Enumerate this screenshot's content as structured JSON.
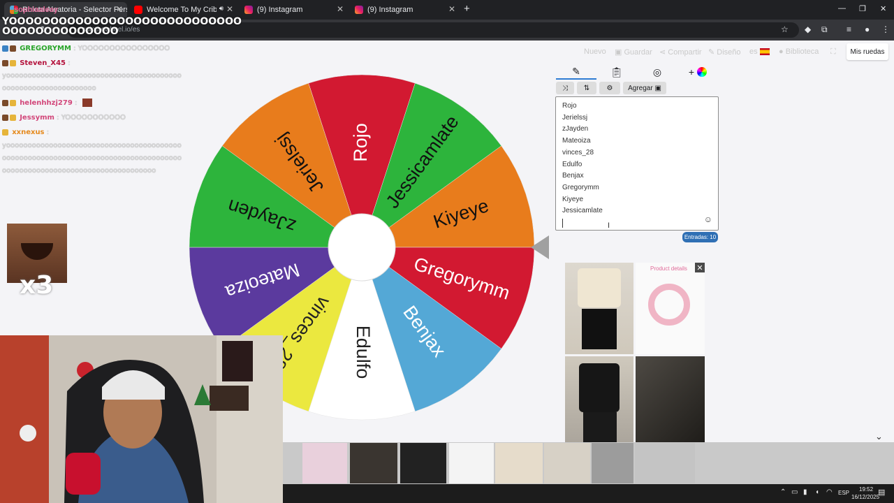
{
  "browser": {
    "tabs": [
      {
        "title": "Ruleta Aleatoria - Selector Perso",
        "active": true
      },
      {
        "title": "Welcome To My Crib - YouTube",
        "active": false
      },
      {
        "title": "(9) Instagram",
        "active": false
      },
      {
        "title": "(9) Instagram",
        "active": false
      }
    ],
    "url": "spinthewheel.io/es"
  },
  "site_menu": {
    "new": "Nuevo",
    "save": "Guardar",
    "share": "Compartir",
    "design": "Diseño",
    "lang": "es",
    "library": "Biblioteca",
    "my_wheels": "Mis ruedas"
  },
  "wheel": {
    "segments": [
      {
        "label": "Rojo",
        "color": "#d21931"
      },
      {
        "label": "Jessicamlate",
        "color": "#2db43c"
      },
      {
        "label": "Kiyeye",
        "color": "#e87c1c"
      },
      {
        "label": "Gregorymm",
        "color": "#d21931"
      },
      {
        "label": "Benjax",
        "color": "#54a8d6"
      },
      {
        "label": "Edulfo",
        "color": "#ffffff"
      },
      {
        "label": "vinces_28",
        "color": "#ebe83f"
      },
      {
        "label": "Mateoiza",
        "color": "#5b3a9e"
      },
      {
        "label": "zJayden",
        "color": "#2db43c"
      },
      {
        "label": "Jerielssj",
        "color": "#e87c1c"
      }
    ]
  },
  "editor": {
    "add_button": "Agregar",
    "entries": [
      "Rojo",
      "Jerielssj",
      "zJayden",
      "Mateoiza",
      "vinces_28",
      "Edulfo",
      "Benjax",
      "Gregorymm",
      "Kiyeye",
      "Jessicamlate"
    ],
    "count_label": "Entradas: 10"
  },
  "ads": {
    "label": "Product details"
  },
  "chat": {
    "overlay_user": "sophiaaleay",
    "overlay_text": "YOOOOOOOOOOOOOOOOOOOOOOOOOOOO\nOOOOOOOOOOOOOO",
    "lines": [
      {
        "user": "GREGORYMM",
        "text": ": YOOOOOOOOOOOOOOOO",
        "color": "#2aa52a"
      },
      {
        "user": "Steven_X45",
        "text": ":",
        "color": "#b4123c"
      },
      {
        "user": "",
        "text": "yooooooooooooooooooooooooooooooooooooooooooooooooooooooooooooooo",
        "color": "#dcdcdc"
      },
      {
        "user": "helenhhzj279",
        "text": ":",
        "color": "#d2477a"
      },
      {
        "user": "Jessymm",
        "text": ": YOOOOOOOOOOO",
        "color": "#d2477a"
      },
      {
        "user": "xxnexus",
        "text": ":",
        "color": "#e58a1e"
      },
      {
        "user": "",
        "text": "yooooooooooooooooooooooooooooooooooooooooooooooooooooooooooooooooooooooooooooooooooooooooooooooooooooooooooooooooooooooo",
        "color": "#dcdcdc"
      }
    ],
    "multiplier": "x3"
  },
  "taskbar": {
    "lang": "ESP",
    "time": "19:52",
    "date": "16/12/2025"
  }
}
